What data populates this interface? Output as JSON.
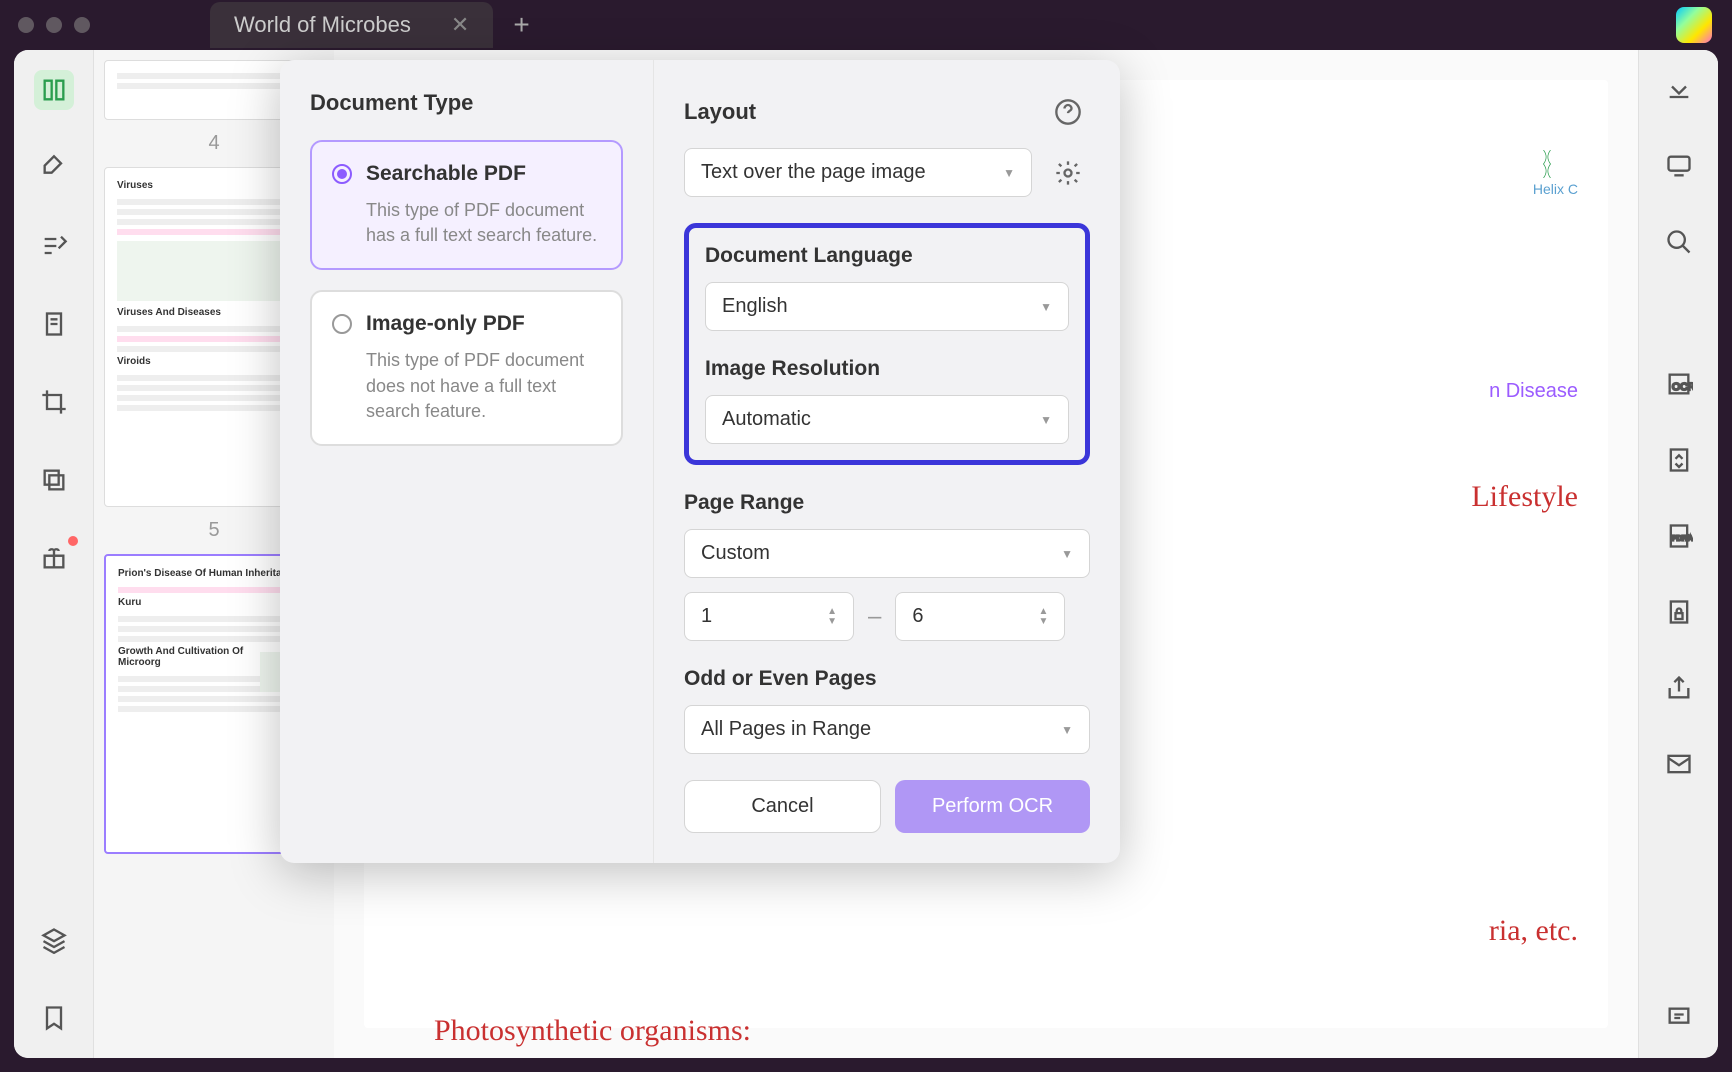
{
  "tab": {
    "title": "World of Microbes"
  },
  "thumbnails": {
    "page4_label": "4",
    "page5_label": "5",
    "t1": {
      "heading": "Viruses",
      "sub1": "Viruses And Diseases",
      "sub2": "Viroids"
    },
    "t2": {
      "heading": "Prion's Disease Of Human Inheritance",
      "sub1": "Kuru",
      "sub2": "Growth And Cultivation Of Microorg"
    }
  },
  "doc": {
    "helix_label": "Helix C",
    "disease_text": "n Disease",
    "lifestyle_text": "Lifestyle",
    "tail1": "ria, etc.",
    "tail2": "Photosynthetic organisms:"
  },
  "modal": {
    "doc_type_title": "Document Type",
    "opt1": {
      "title": "Searchable PDF",
      "desc": "This type of PDF document has a full text search feature."
    },
    "opt2": {
      "title": "Image-only PDF",
      "desc": "This type of PDF document does not have a full text search feature."
    },
    "layout_label": "Layout",
    "layout_value": "Text over the page image",
    "lang_label": "Document Language",
    "lang_value": "English",
    "res_label": "Image Resolution",
    "res_value": "Automatic",
    "range_label": "Page Range",
    "range_value": "Custom",
    "range_from": "1",
    "range_to": "6",
    "odd_label": "Odd or Even Pages",
    "odd_value": "All Pages in Range",
    "cancel": "Cancel",
    "confirm": "Perform OCR"
  }
}
